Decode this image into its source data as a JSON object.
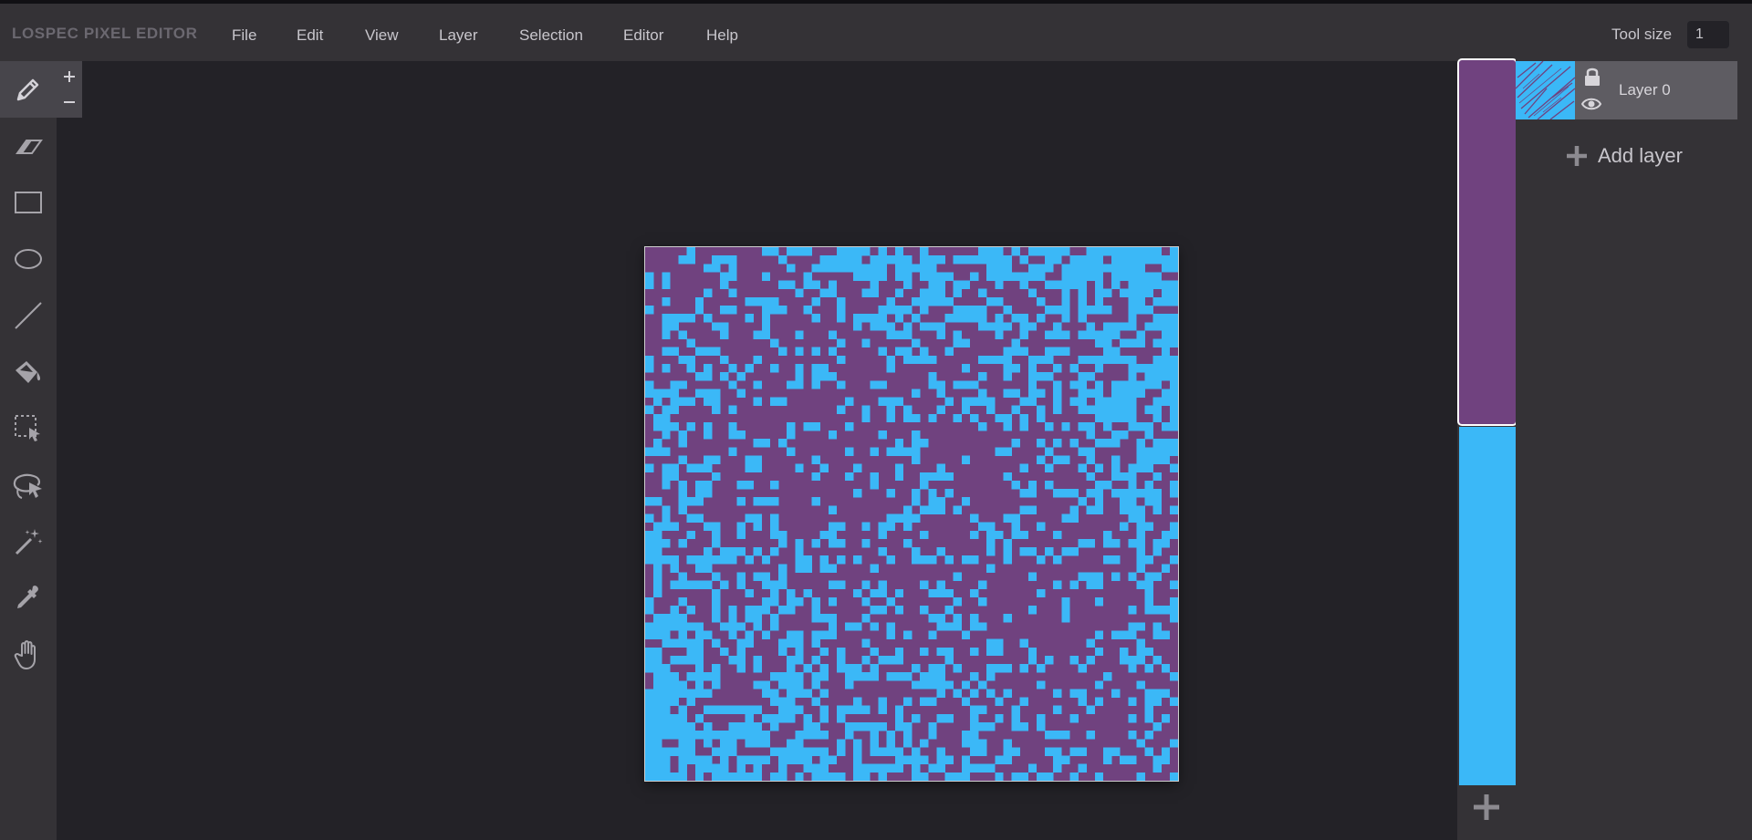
{
  "app": {
    "brand": "LOSPEC PIXEL EDITOR",
    "menu": [
      {
        "id": "file",
        "label": "File"
      },
      {
        "id": "edit",
        "label": "Edit"
      },
      {
        "id": "view",
        "label": "View"
      },
      {
        "id": "layer",
        "label": "Layer"
      },
      {
        "id": "selection",
        "label": "Selection"
      },
      {
        "id": "editor",
        "label": "Editor"
      },
      {
        "id": "help",
        "label": "Help"
      }
    ],
    "tool_size": {
      "label": "Tool size",
      "value": "1"
    }
  },
  "tools": [
    {
      "name": "pencil-icon",
      "active": true
    },
    {
      "name": "eraser-icon"
    },
    {
      "name": "rectangle-icon"
    },
    {
      "name": "ellipse-icon"
    },
    {
      "name": "line-icon"
    },
    {
      "name": "fill-bucket-icon"
    },
    {
      "name": "rectangle-select-icon"
    },
    {
      "name": "lasso-select-icon"
    },
    {
      "name": "magic-wand-icon"
    },
    {
      "name": "eyedropper-icon"
    },
    {
      "name": "pan-hand-icon"
    }
  ],
  "tool_size_buttons": [
    "plus-icon",
    "minus-icon"
  ],
  "colors": {
    "purple": "#70427f",
    "blue": "#3bb8f7",
    "chrome": "#343236",
    "workspace": "#232227",
    "text": "#c8c6cc"
  },
  "palette": {
    "swatches": [
      {
        "name": "purple",
        "color": "#70427f",
        "selected": true
      },
      {
        "name": "blue",
        "color": "#3bb8f7",
        "selected": false
      }
    ],
    "add_icon": "plus-icon"
  },
  "layers": {
    "items": [
      {
        "name": "Layer 0",
        "locked_icon": "lock-icon",
        "visibility_icon": "eye-icon"
      }
    ],
    "add_label": "Add layer"
  },
  "canvas": {
    "pattern": "diagonal noise, blue regions on purple",
    "grid_size": 64
  }
}
